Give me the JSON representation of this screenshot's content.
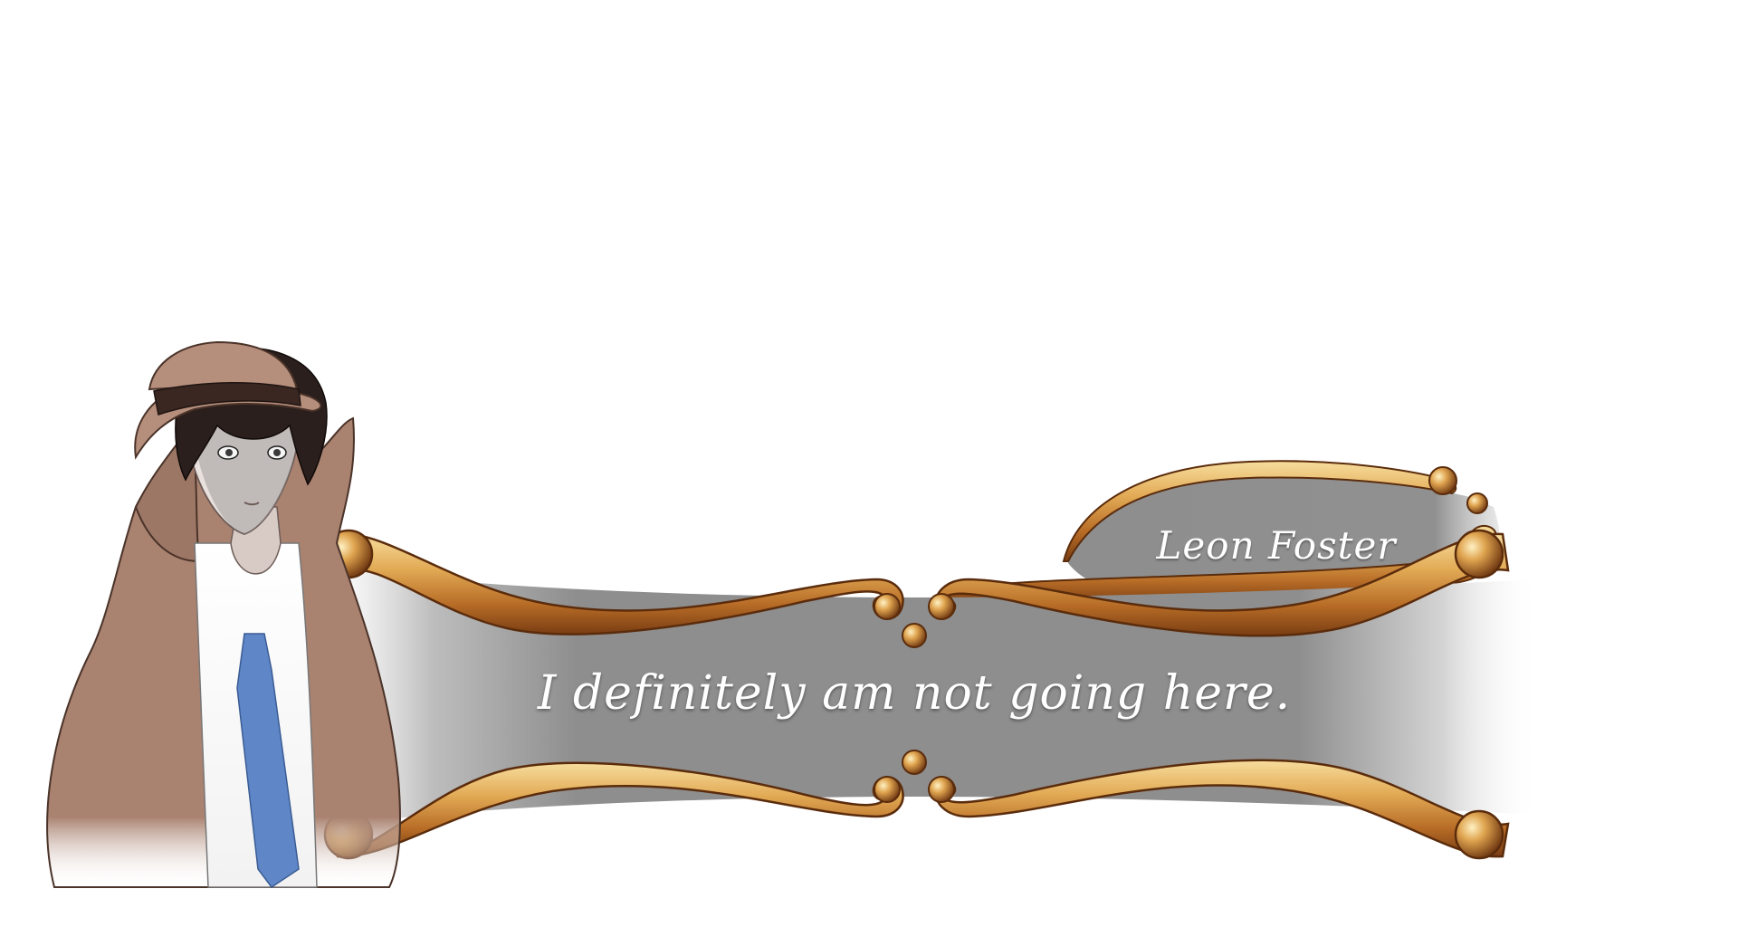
{
  "dialogue": {
    "speaker": "Leon Foster",
    "line": "I definitely am not going here."
  },
  "character": {
    "name": "Leon Foster"
  },
  "colors": {
    "banner_gray": "#8e8e8e",
    "gold_light": "#f3cf86",
    "gold_mid": "#d7963d",
    "gold_dark": "#8b4a16",
    "coat": "#a98270",
    "hair": "#2a1f1c",
    "tie": "#5f87c7"
  },
  "icons": {
    "ornament": "gold-scroll-frame-icon",
    "portrait": "character-portrait-icon"
  }
}
